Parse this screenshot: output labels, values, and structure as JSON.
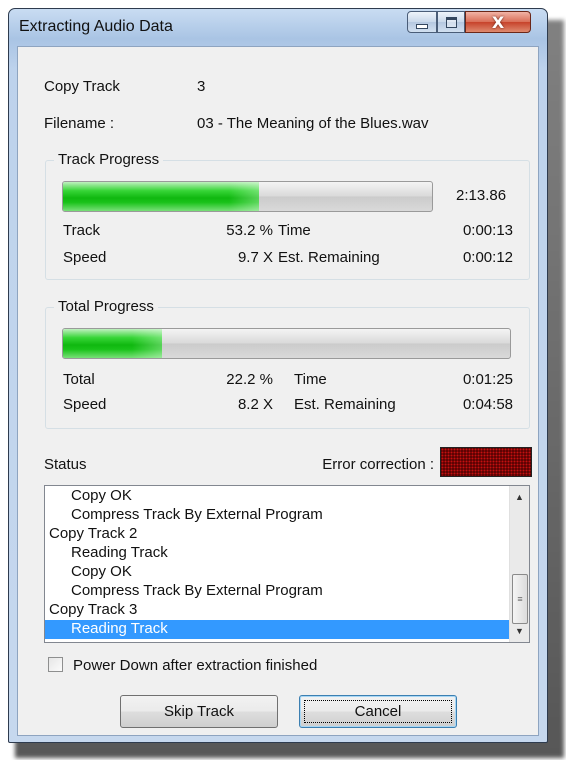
{
  "window": {
    "title": "Extracting Audio Data",
    "close_glyph": "X"
  },
  "info": {
    "copy_track_label": "Copy Track",
    "copy_track_value": "3",
    "filename_label": "Filename :",
    "filename_value": "03 - The Meaning of the Blues.wav"
  },
  "track_progress": {
    "legend": "Track Progress",
    "bar_percent": 53.2,
    "duration": "2:13.86",
    "track_label": "Track",
    "track_value": "53.2 %",
    "time_label": "Time",
    "time_value": "0:00:13",
    "speed_label": "Speed",
    "speed_value": "9.7 X",
    "remaining_label": "Est. Remaining",
    "remaining_value": "0:00:12"
  },
  "total_progress": {
    "legend": "Total Progress",
    "bar_percent": 22.2,
    "total_label": "Total",
    "total_value": "22.2 %",
    "time_label": "Time",
    "time_value": "0:01:25",
    "speed_label": "Speed",
    "speed_value": "8.2 X",
    "remaining_label": "Est. Remaining",
    "remaining_value": "0:04:58"
  },
  "status": {
    "label": "Status",
    "error_correction_label": "Error correction :",
    "log": [
      {
        "text": "Copy OK",
        "indent": true,
        "selected": false
      },
      {
        "text": "Compress Track By External Program",
        "indent": true,
        "selected": false
      },
      {
        "text": "Copy Track  2",
        "indent": false,
        "selected": false
      },
      {
        "text": "Reading Track",
        "indent": true,
        "selected": false
      },
      {
        "text": "Copy OK",
        "indent": true,
        "selected": false
      },
      {
        "text": "Compress Track By External Program",
        "indent": true,
        "selected": false
      },
      {
        "text": "Copy Track  3",
        "indent": false,
        "selected": false
      },
      {
        "text": "Reading Track",
        "indent": true,
        "selected": true
      }
    ]
  },
  "options": {
    "power_down_label": "Power Down after extraction finished",
    "power_down_checked": false
  },
  "buttons": {
    "skip_track": "Skip Track",
    "cancel": "Cancel"
  },
  "colors": {
    "progress_fill": "#10b810",
    "selection": "#3399ff",
    "led_background": "#4a0000",
    "led_dot": "#c41010"
  },
  "icons": {
    "minimize": "minimize-icon",
    "maximize": "maximize-icon",
    "close": "close-icon",
    "scroll_up": "chevron-up-icon",
    "scroll_down": "chevron-down-icon"
  }
}
